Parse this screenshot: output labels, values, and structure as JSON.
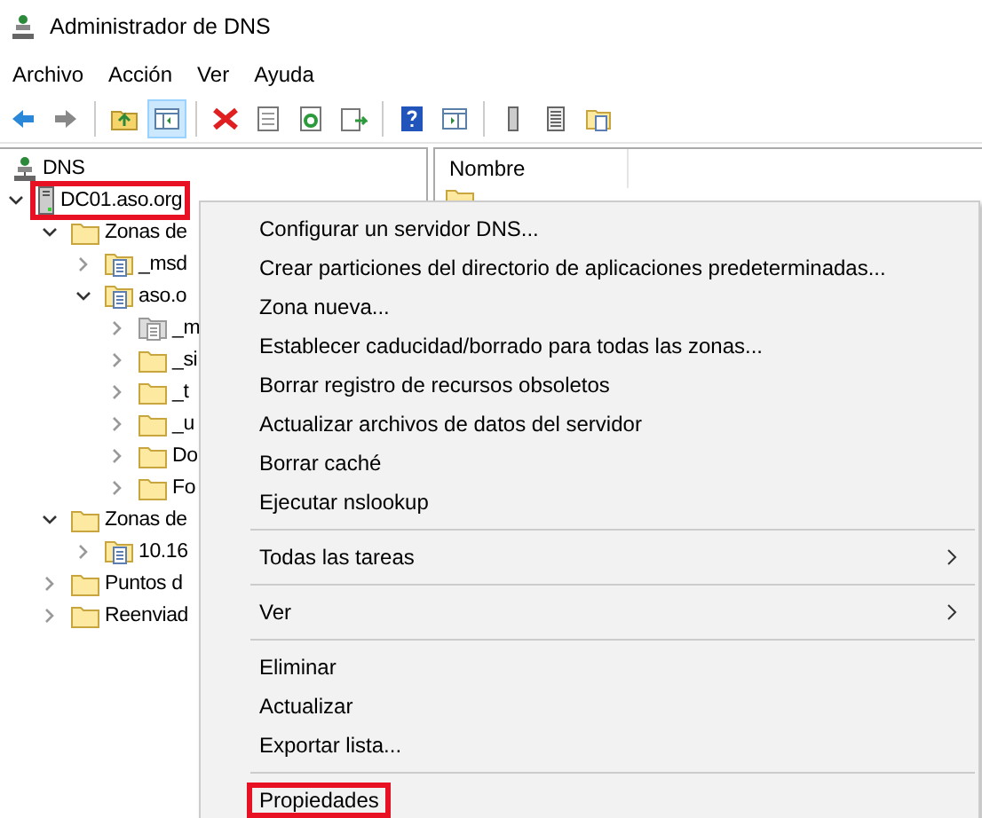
{
  "window": {
    "title": "Administrador de DNS"
  },
  "menu_bar": [
    "Archivo",
    "Acción",
    "Ver",
    "Ayuda"
  ],
  "tree": [
    {
      "label": "DNS",
      "kind": "dns",
      "highlighted": false,
      "children": [
        {
          "label": "DC01.aso.org",
          "kind": "server",
          "highlighted": true,
          "expanded": true,
          "children": [
            {
              "label": "Zonas de",
              "kind": "folder",
              "highlighted": false,
              "expanded": true,
              "children": [
                {
                  "label": "_msd",
                  "kind": "zone",
                  "highlighted": false,
                  "expanded": false
                },
                {
                  "label": "aso.o",
                  "kind": "zone",
                  "highlighted": false,
                  "expanded": true,
                  "children": [
                    {
                      "label": "_m",
                      "kind": "zone-grey",
                      "highlighted": false,
                      "expanded": false
                    },
                    {
                      "label": "_si",
                      "kind": "folder",
                      "highlighted": false,
                      "expanded": false
                    },
                    {
                      "label": "_t",
                      "kind": "folder",
                      "highlighted": false,
                      "expanded": false
                    },
                    {
                      "label": "_u",
                      "kind": "folder",
                      "highlighted": false,
                      "expanded": false
                    },
                    {
                      "label": "Do",
                      "kind": "folder",
                      "highlighted": false,
                      "expanded": false
                    },
                    {
                      "label": "Fo",
                      "kind": "folder",
                      "highlighted": false,
                      "expanded": false
                    }
                  ]
                }
              ]
            },
            {
              "label": "Zonas de",
              "kind": "folder",
              "highlighted": false,
              "expanded": true,
              "children": [
                {
                  "label": "10.16",
                  "kind": "zone",
                  "highlighted": false,
                  "expanded": false
                }
              ]
            },
            {
              "label": "Puntos d",
              "kind": "folder",
              "highlighted": false,
              "expanded": false
            },
            {
              "label": "Reenviad",
              "kind": "folder",
              "highlighted": false,
              "expanded": false
            }
          ]
        }
      ]
    }
  ],
  "list": {
    "columns": [
      "Nombre"
    ]
  },
  "context_menu": [
    {
      "kind": "item",
      "label": "Configurar un servidor DNS...",
      "highlighted": false
    },
    {
      "kind": "item",
      "label": "Crear particiones del directorio de aplicaciones predeterminadas...",
      "highlighted": false
    },
    {
      "kind": "item",
      "label": "Zona nueva...",
      "highlighted": false
    },
    {
      "kind": "item",
      "label": "Establecer caducidad/borrado para todas las zonas...",
      "highlighted": false
    },
    {
      "kind": "item",
      "label": "Borrar registro de recursos obsoletos",
      "highlighted": false
    },
    {
      "kind": "item",
      "label": "Actualizar archivos de datos del servidor",
      "highlighted": false
    },
    {
      "kind": "item",
      "label": "Borrar caché",
      "highlighted": false
    },
    {
      "kind": "item",
      "label": "Ejecutar nslookup",
      "highlighted": false
    },
    {
      "kind": "separator"
    },
    {
      "kind": "submenu",
      "label": "Todas las tareas",
      "highlighted": false
    },
    {
      "kind": "separator"
    },
    {
      "kind": "submenu",
      "label": "Ver",
      "highlighted": false
    },
    {
      "kind": "separator"
    },
    {
      "kind": "item",
      "label": "Eliminar",
      "highlighted": false
    },
    {
      "kind": "item",
      "label": "Actualizar",
      "highlighted": false
    },
    {
      "kind": "item",
      "label": "Exportar lista...",
      "highlighted": false
    },
    {
      "kind": "separator"
    },
    {
      "kind": "item",
      "label": "Propiedades",
      "highlighted": true
    }
  ]
}
